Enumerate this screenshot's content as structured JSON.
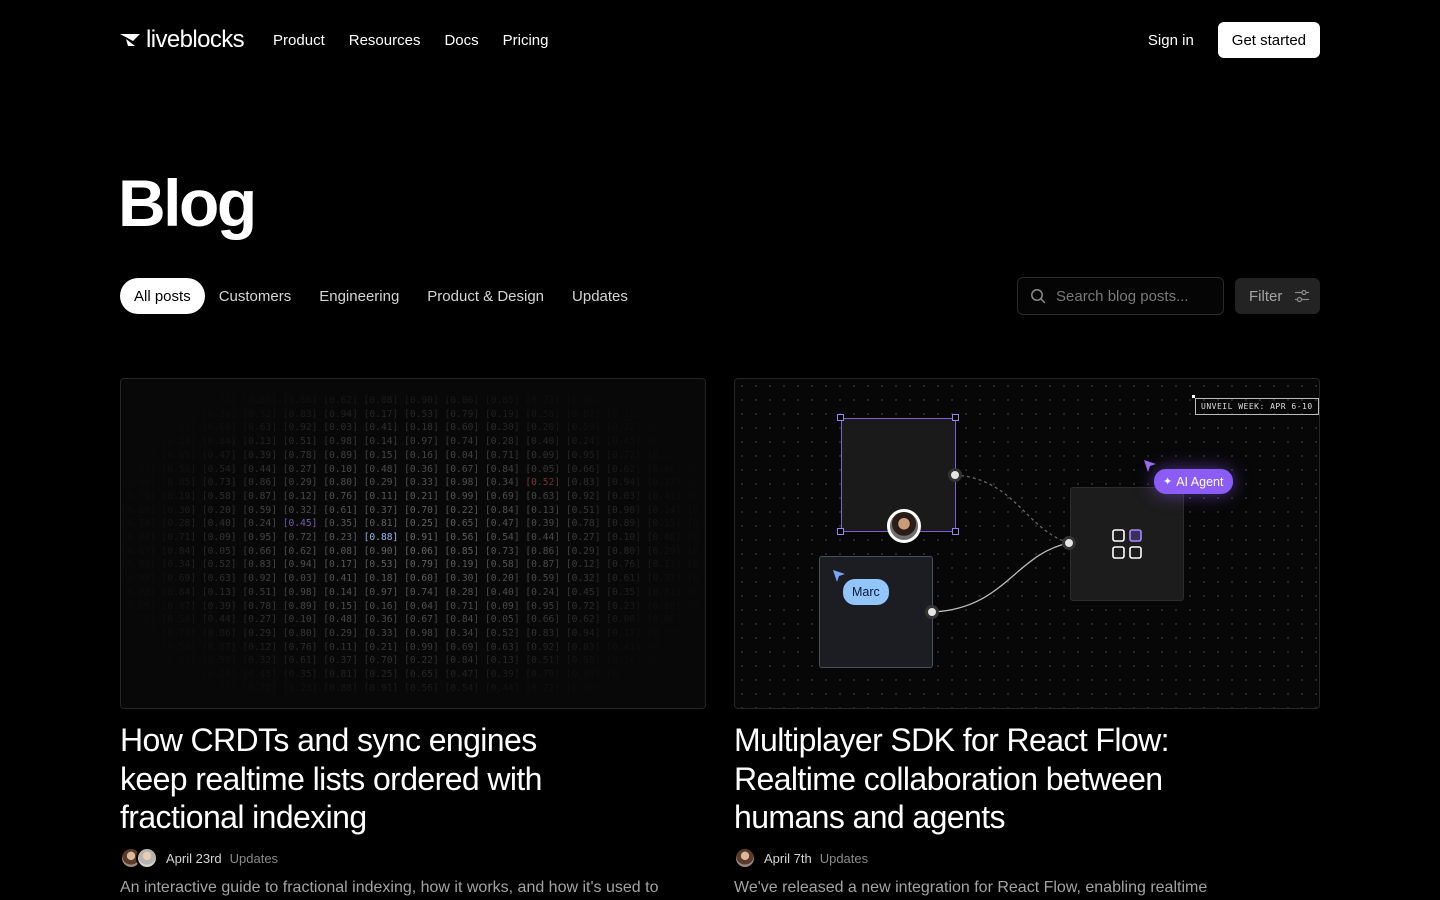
{
  "nav": {
    "logo_text": "liveblocks",
    "links": [
      "Product",
      "Resources",
      "Docs",
      "Pricing"
    ],
    "sign_in": "Sign in",
    "cta": "Get started"
  },
  "page": {
    "title": "Blog"
  },
  "filters": {
    "tabs": [
      "All posts",
      "Customers",
      "Engineering",
      "Product & Design",
      "Updates"
    ],
    "active_tab": "All posts",
    "search_placeholder": "Search blog posts...",
    "filter_label": "Filter"
  },
  "posts": [
    {
      "title": "How CRDTs and sync engines keep realtime lists ordered with fractional indexing",
      "date": "April 23rd",
      "category": "Updates",
      "excerpt": "An interactive guide to fractional indexing, how it works, and how it's used to",
      "illustration": "fractional-index-matrix"
    },
    {
      "title": "Multiplayer SDK for React Flow: Realtime collaboration between humans and agents",
      "date": "April 7th",
      "category": "Updates",
      "excerpt": "We've released a new integration for React Flow, enabling realtime",
      "illustration": {
        "tag": "UNVEIL WEEK: APR 6-10",
        "user_cursor": "Marc",
        "agent_cursor": "AI Agent"
      }
    }
  ],
  "colors": {
    "background": "#000000",
    "accent_purple": "#8b5cf6",
    "cursor_blue": "#93c5fd"
  }
}
